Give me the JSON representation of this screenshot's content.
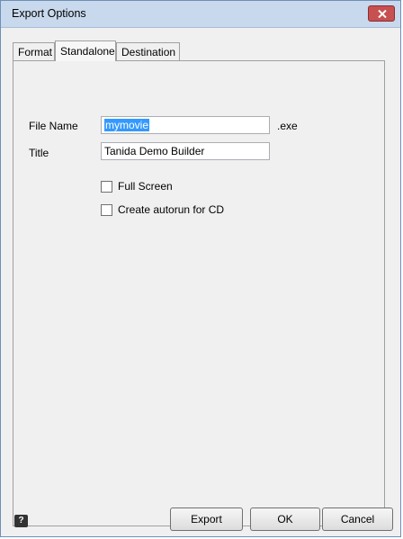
{
  "window": {
    "title": "Export Options"
  },
  "tabs": [
    {
      "label": "Format",
      "active": false
    },
    {
      "label": "Standalone",
      "active": true
    },
    {
      "label": "Destination",
      "active": false
    }
  ],
  "standalone": {
    "file_name_label": "File Name",
    "file_name_value": "mymovie",
    "file_extension": ".exe",
    "title_label": "Title",
    "title_value": "Tanida Demo Builder",
    "full_screen_label": "Full Screen",
    "full_screen_checked": false,
    "autorun_label": "Create autorun for CD",
    "autorun_checked": false
  },
  "footer": {
    "help_icon_glyph": "?",
    "export_label": "Export",
    "ok_label": "OK",
    "cancel_label": "Cancel"
  },
  "icons": {
    "close": "close-icon",
    "help": "help-icon"
  },
  "colors": {
    "titlebar": "#c9d9ed",
    "close_button": "#c75050",
    "selection": "#3399ff",
    "dialog_bg": "#f0f0f0"
  }
}
